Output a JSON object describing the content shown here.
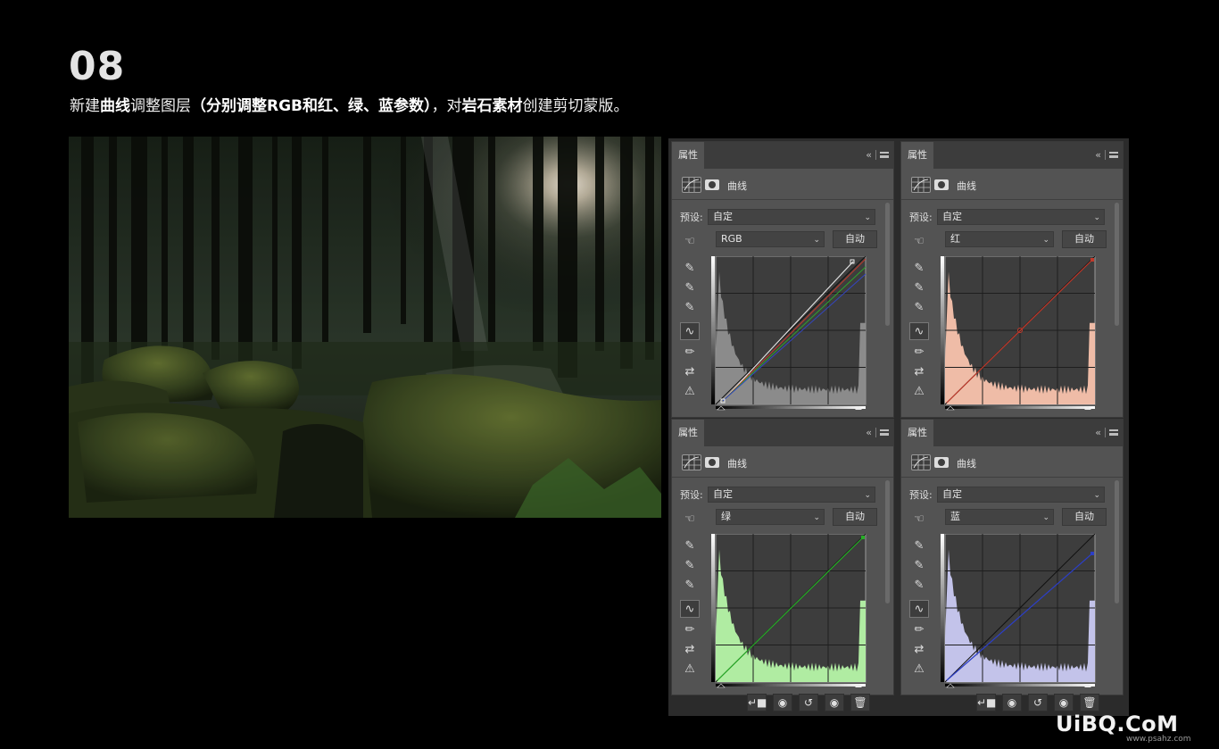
{
  "step_number": "08",
  "instruction": {
    "p1": "新建",
    "b1": "曲线",
    "p2": "调整图层",
    "b2": "（分别调整RGB和红、绿、蓝参数）",
    "p3": "，对",
    "b3": "岩石素材",
    "p4": "创建剪切蒙版。"
  },
  "panels": [
    {
      "tab": "属性",
      "adjustment": "曲线",
      "preset_label": "预设:",
      "preset": "自定",
      "channel": "RGB",
      "auto_label": "自动",
      "histogram_color": "#8f8f8f",
      "curve_color": "#ffffff"
    },
    {
      "tab": "属性",
      "adjustment": "曲线",
      "preset_label": "预设:",
      "preset": "自定",
      "channel": "红",
      "auto_label": "自动",
      "histogram_color": "#f9c3ad",
      "curve_color": "#c0392b"
    },
    {
      "tab": "属性",
      "adjustment": "曲线",
      "preset_label": "预设:",
      "preset": "自定",
      "channel": "绿",
      "auto_label": "自动",
      "histogram_color": "#b6f5a8",
      "curve_color": "#27ae27"
    },
    {
      "tab": "属性",
      "adjustment": "曲线",
      "preset_label": "预设:",
      "preset": "自定",
      "channel": "蓝",
      "auto_label": "自动",
      "histogram_color": "#cacaf3",
      "curve_color": "#2c3ec7"
    }
  ],
  "tools": [
    "on-image-adjust-icon",
    "black-point-eyedropper-icon",
    "gray-point-eyedropper-icon",
    "white-point-eyedropper-icon",
    "curve-points-icon",
    "pencil-icon",
    "smooth-icon",
    "clipping-warning-icon"
  ],
  "footer_buttons": [
    "clip-to-layer-icon",
    "view-previous-icon",
    "reset-icon",
    "visibility-eye-icon",
    "delete-trash-icon"
  ],
  "watermark": {
    "main": "UiBQ.CoM",
    "sub": "www.psahz.com"
  },
  "colors": {
    "background": "#000000",
    "panel": "#535353",
    "graph_bg": "#3d3d3d"
  }
}
